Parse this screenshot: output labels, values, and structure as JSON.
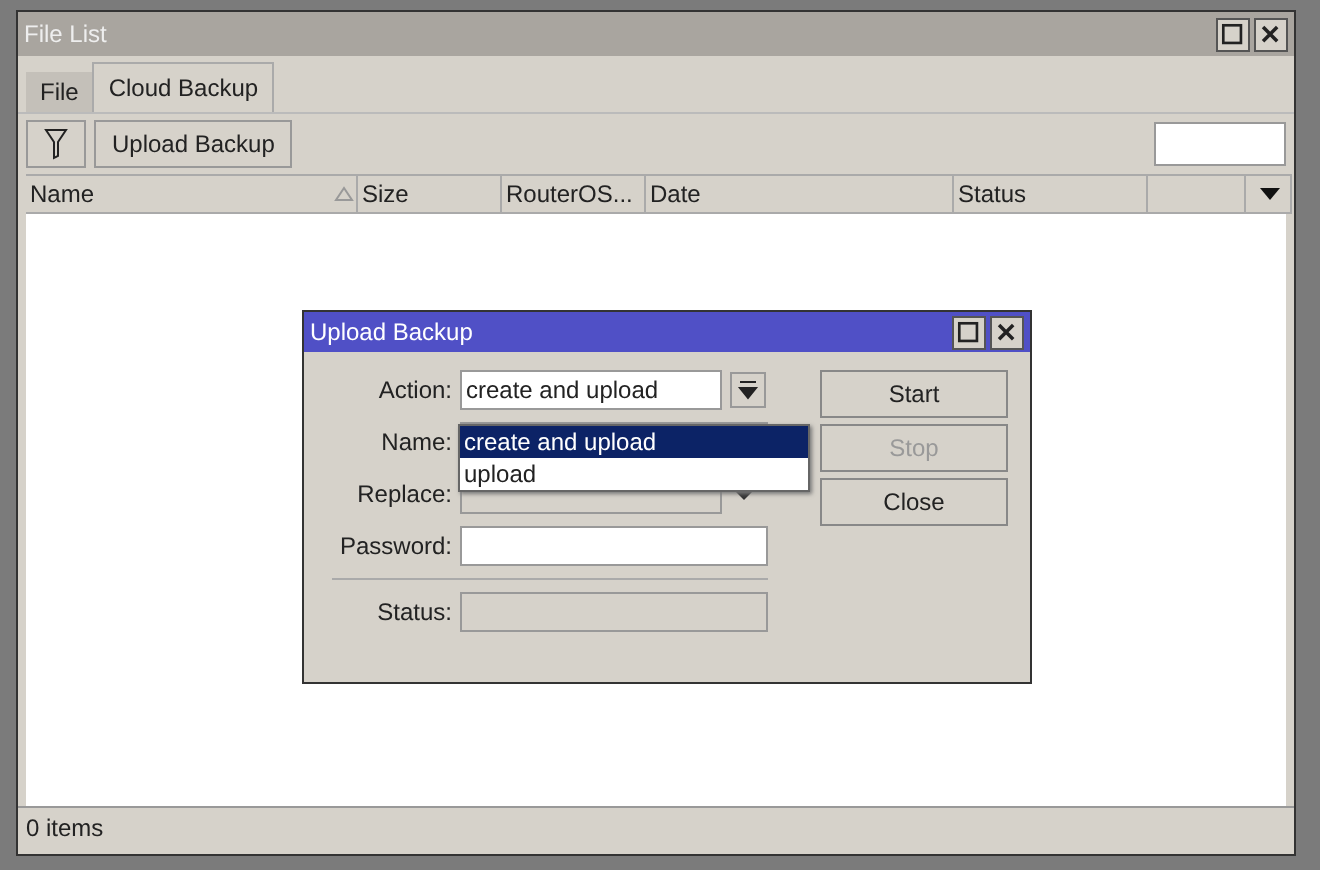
{
  "window": {
    "title": "File List"
  },
  "tabs": [
    {
      "label": "File",
      "selected": false
    },
    {
      "label": "Cloud Backup",
      "selected": true
    }
  ],
  "toolbar": {
    "button": "Upload Backup"
  },
  "table": {
    "columns": [
      {
        "label": "Name",
        "sorted": true
      },
      {
        "label": "Size",
        "sorted": false
      },
      {
        "label": "RouterOS...",
        "sorted": false
      },
      {
        "label": "Date",
        "sorted": false
      },
      {
        "label": "Status",
        "sorted": false
      }
    ]
  },
  "status_bar": "0 items",
  "dialog": {
    "title": "Upload Backup",
    "fields": [
      {
        "label": "Action:",
        "kind": "combo",
        "value": "create and upload"
      },
      {
        "label": "Name:",
        "kind": "text"
      },
      {
        "label": "Replace:",
        "kind": "select",
        "disabled": true
      },
      {
        "label": "Password:",
        "kind": "text"
      },
      {
        "label": "Status:",
        "kind": "status"
      }
    ],
    "buttons": [
      {
        "label": "Start",
        "disabled": false
      },
      {
        "label": "Stop",
        "disabled": true
      },
      {
        "label": "Close",
        "disabled": false
      }
    ],
    "options": [
      {
        "label": "create and upload",
        "selected": true
      },
      {
        "label": "upload",
        "selected": false
      }
    ]
  }
}
